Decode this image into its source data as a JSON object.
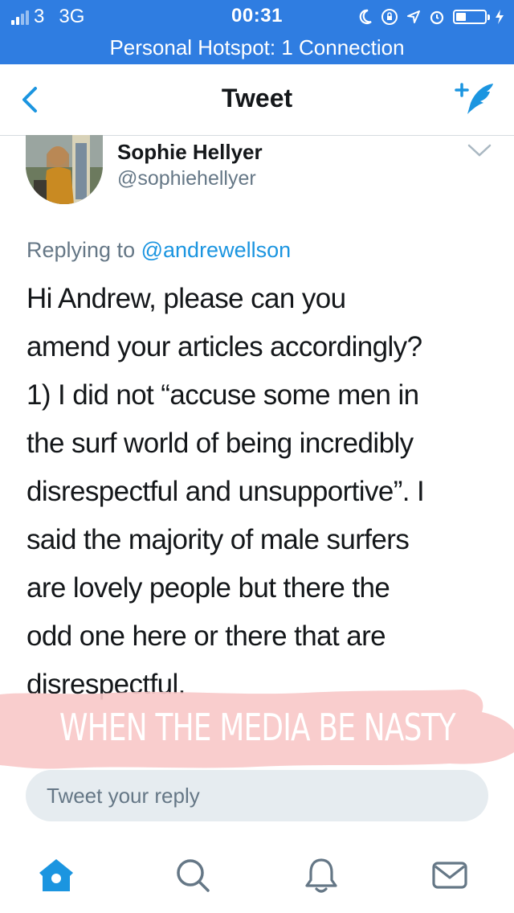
{
  "status_bar": {
    "carrier": "3",
    "network": "3G",
    "time": "00:31"
  },
  "hotspot_banner": "Personal Hotspot: 1 Connection",
  "nav": {
    "title": "Tweet"
  },
  "tweet": {
    "author_name": "Sophie Hellyer",
    "author_handle": "@sophiehellyer",
    "replying_prefix": "Replying to",
    "replying_to": "@andrewellson",
    "text_lines": [
      "Hi Andrew, please can you",
      "amend your articles accordingly?",
      "1) I did not “accuse some men in",
      "the surf world of being incredibly",
      "disrespectful and unsupportive”. I",
      "said the majority of male surfers",
      "are lovely people but there the",
      "odd one here or there that are",
      "disrespectful."
    ]
  },
  "sticker": {
    "text": "WHEN THE MEDIA BE NASTY",
    "color": "#f9c9c9"
  },
  "reply_box": {
    "placeholder": "Tweet your reply"
  },
  "tabbar": {
    "tabs": [
      "home",
      "search",
      "notifications",
      "messages"
    ],
    "active": "home"
  },
  "colors": {
    "status_bar": "#2f7de1",
    "accent": "#1b95e0",
    "secondary_text": "#657786",
    "reply_box_bg": "#e6ecf0"
  }
}
